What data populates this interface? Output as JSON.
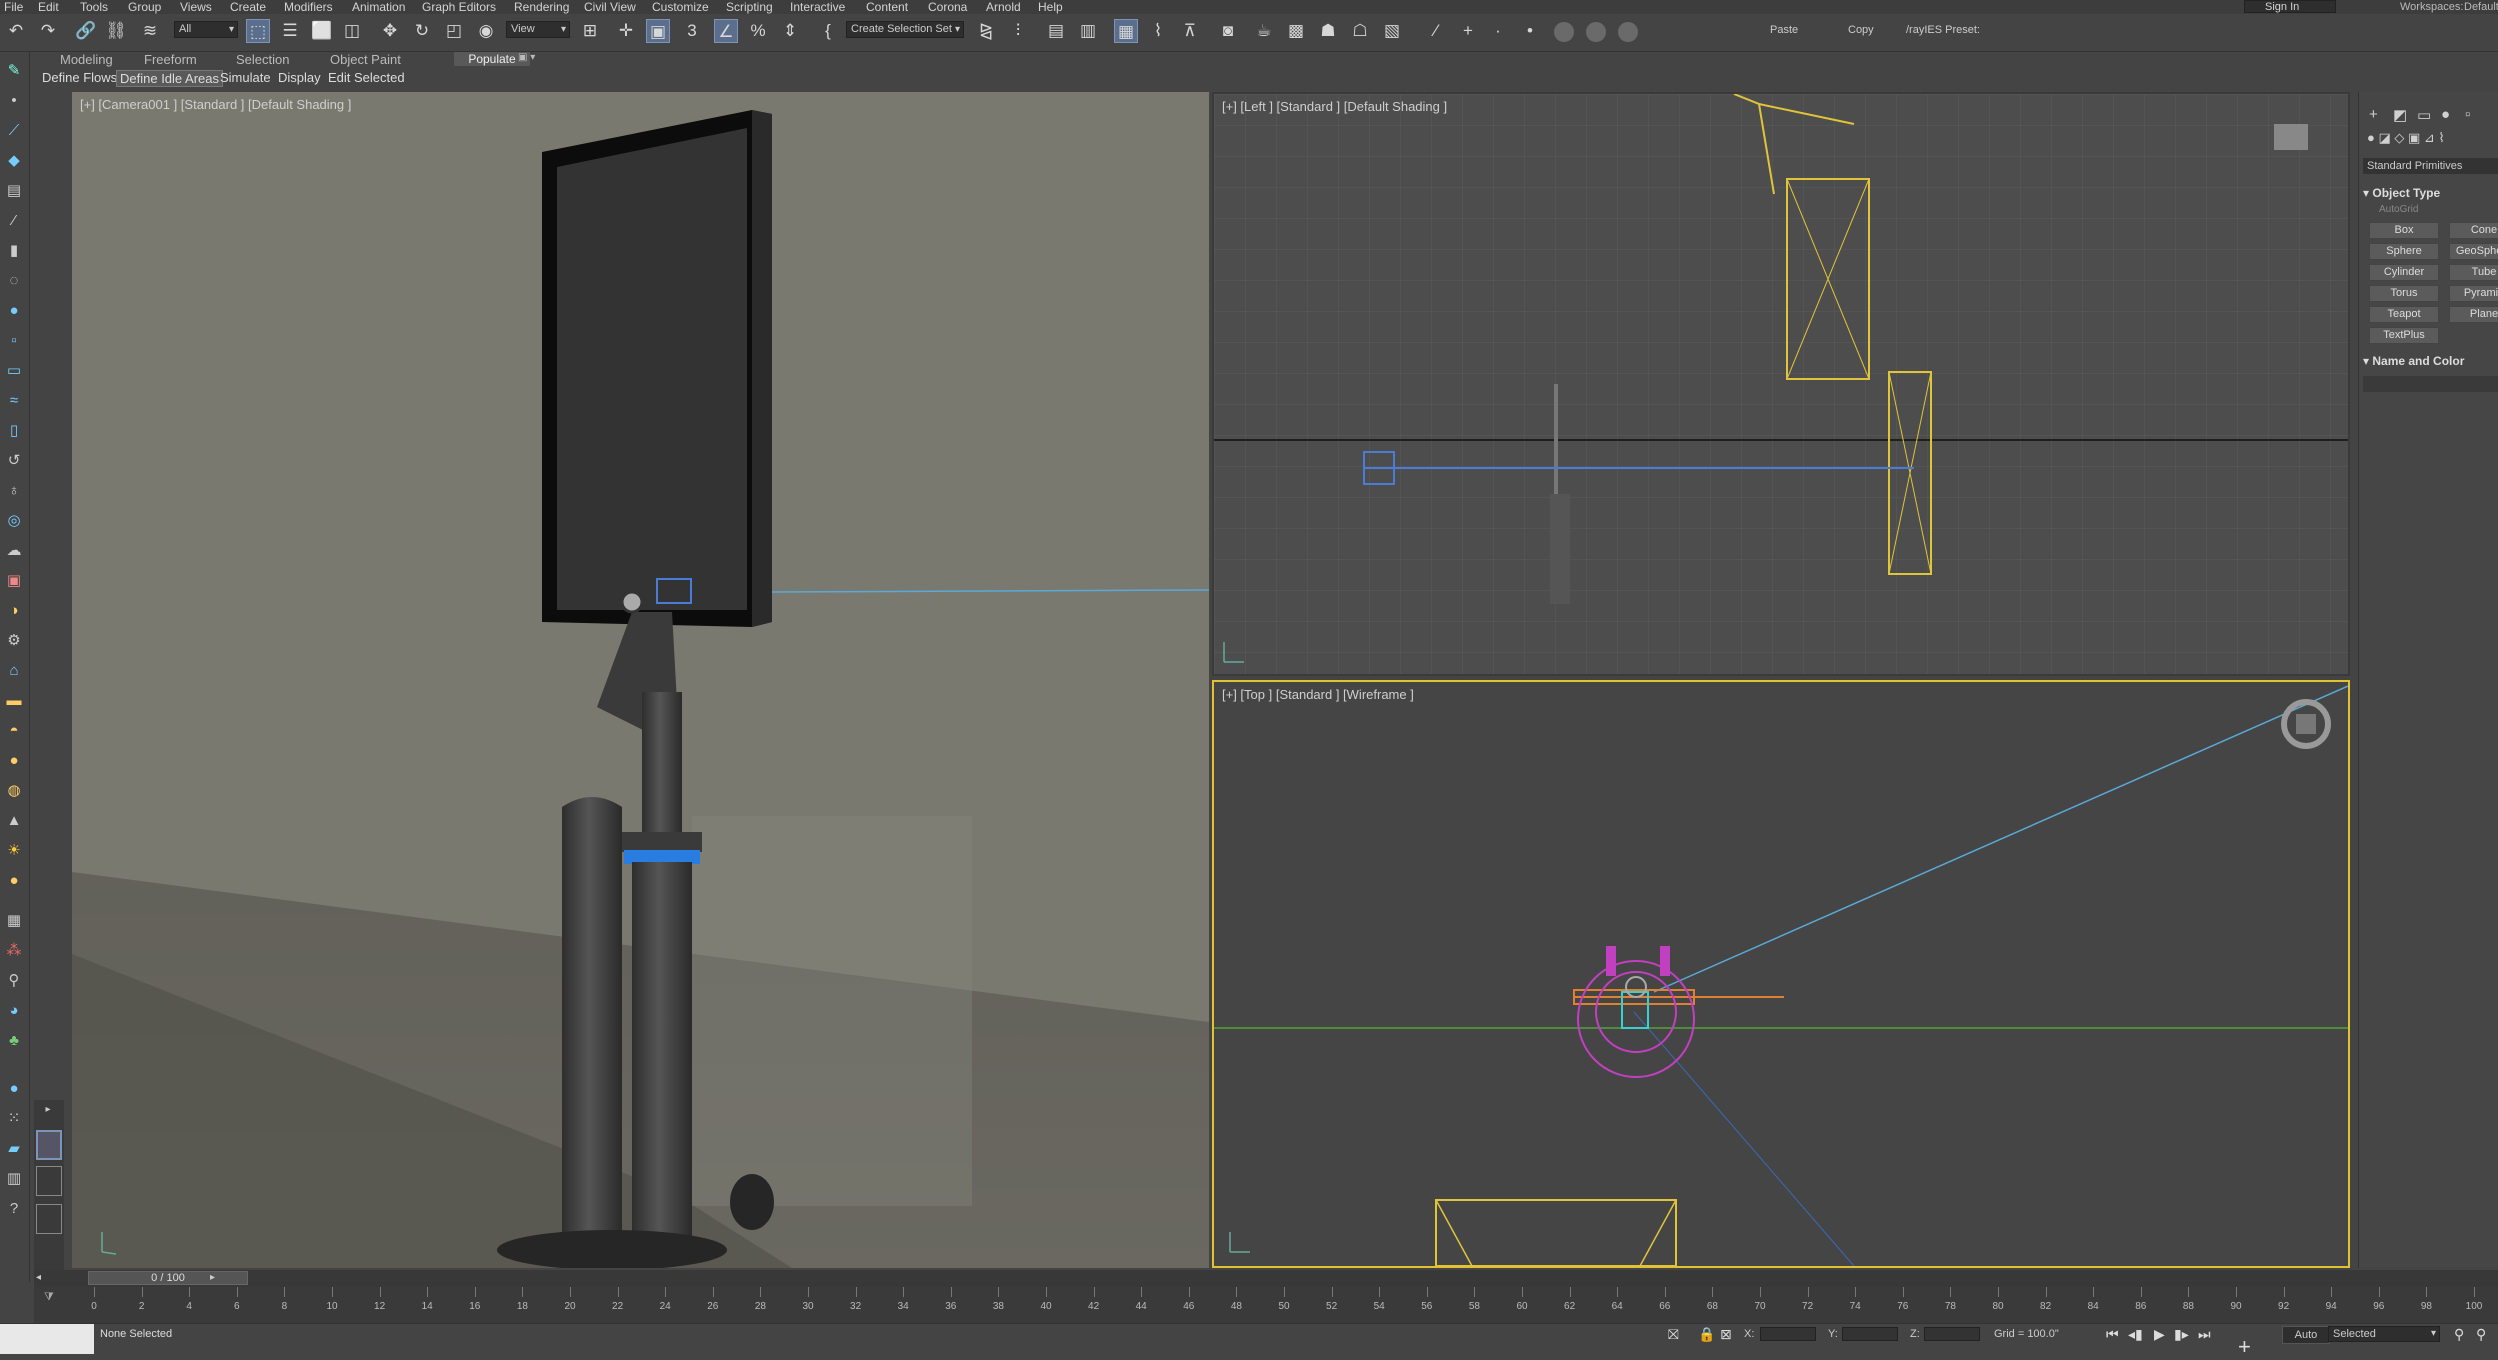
{
  "menubar": {
    "items": [
      "File",
      "Edit",
      "Tools",
      "Group",
      "Views",
      "Create",
      "Modifiers",
      "Animation",
      "Graph Editors",
      "Rendering",
      "Civil View",
      "Customize",
      "Scripting",
      "Interactive",
      "Content",
      "Corona",
      "Arnold",
      "Help"
    ],
    "sign_in": "Sign In",
    "workspaces_label": "Workspaces:",
    "workspaces_value": "Default"
  },
  "toolbar": {
    "filter_value": "All",
    "view_value": "View",
    "selection_set_placeholder": "Create Selection Set",
    "paste_label": "Paste",
    "copy_label": "Copy",
    "preset_label": "/rayIES Preset:",
    "icons": [
      "undo-icon",
      "redo-icon",
      "link-icon",
      "unlink-icon",
      "bind-space-warp-icon",
      "select-object-icon",
      "select-by-name-icon",
      "rect-region-icon",
      "window-crossing-icon",
      "move-icon",
      "rotate-icon",
      "scale-icon",
      "placement-icon",
      "use-pivot-icon",
      "keyboard-shortcut-override-icon",
      "snaps-icon",
      "angle-snap-icon",
      "percent-snap-icon",
      "spinner-snap-icon",
      "edit-named-sets-icon",
      "mirror-icon",
      "align-icon",
      "layer-explorer-icon",
      "toggle-ribbon-icon",
      "curve-editor-icon",
      "schematic-view-icon",
      "material-editor-icon",
      "render-setup-icon",
      "rendered-frame-icon",
      "render-production-icon",
      "render-iterative-icon"
    ]
  },
  "ribbon": {
    "tabs": [
      "Modeling",
      "Freeform",
      "Selection",
      "Object Paint",
      "Populate"
    ],
    "active_tab": "Populate",
    "subtabs": [
      "Define Flows",
      "Define Idle Areas",
      "Simulate",
      "Display",
      "Edit Selected"
    ],
    "highlighted_subtab": "Define Idle Areas"
  },
  "viewports": {
    "camera": {
      "label": "[+] [Camera001 ] [Standard ] [Default Shading ]"
    },
    "left": {
      "label": "[+] [Left ] [Standard ] [Default Shading ]"
    },
    "top": {
      "label": "[+] [Top ] [Standard ] [Wireframe ]"
    }
  },
  "command_panel": {
    "tab_icons": [
      "create-tab-icon",
      "modify-tab-icon",
      "hierarchy-tab-icon",
      "motion-tab-icon",
      "display-tab-icon",
      "utilities-tab-icon"
    ],
    "category": "Standard Primitives",
    "object_type_title": "Object Type",
    "autogrid_label": "AutoGrid",
    "buttons": [
      "Box",
      "Cone",
      "Sphere",
      "GeoSphere",
      "Cylinder",
      "Tube",
      "Torus",
      "Pyramid",
      "Teapot",
      "Plane",
      "TextPlus"
    ],
    "name_color_title": "Name and Color"
  },
  "timeline": {
    "frame_display": "0 / 100",
    "ticks": [
      "0",
      "2",
      "4",
      "6",
      "8",
      "10",
      "12",
      "14",
      "16",
      "18",
      "20",
      "22",
      "24",
      "26",
      "28",
      "30",
      "32",
      "34",
      "36",
      "38",
      "40",
      "42",
      "44",
      "46",
      "48",
      "50",
      "52",
      "54",
      "56",
      "58",
      "60",
      "62",
      "64",
      "66",
      "68",
      "70",
      "72",
      "74",
      "76",
      "78",
      "80",
      "82",
      "84",
      "86",
      "88",
      "90",
      "92",
      "94",
      "96",
      "98",
      "100"
    ]
  },
  "status": {
    "selection_text": "None Selected",
    "x_label": "X:",
    "y_label": "Y:",
    "z_label": "Z:",
    "grid_label": "Grid = 100.0\"",
    "auto_label": "Auto",
    "selected_value": "Selected"
  },
  "colors": {
    "active_viewport_border": "#e3c232",
    "highlight_blue": "#5b6f8c",
    "wire_yellow": "#e0c43a",
    "wire_blue": "#4a7bd6",
    "wire_magenta": "#c040c0",
    "wire_cyan": "#3ad0d0",
    "wire_orange": "#e08030"
  }
}
